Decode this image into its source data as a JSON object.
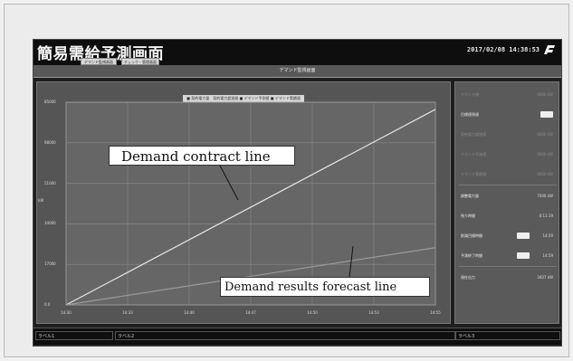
{
  "app": {
    "title": "簡易需給予測画面",
    "datetime": "2017/02/08 14:38:53",
    "buttons": [
      "デマンド監視画面",
      "チェック・管理画面"
    ],
    "logo_icon": "brand-logo-icon"
  },
  "subheader": {
    "title": "デマンド監視画面"
  },
  "chart_data": {
    "type": "line",
    "legend_text": "■ 契約電力量　契約電力超過値 ■ デマンド予測値 ■ デマンド実績値",
    "y_ticks": [
      "85000",
      "68000",
      "51000",
      "34000",
      "17000",
      "0.0"
    ],
    "ylabel": "kW",
    "x_ticks": [
      "14:30",
      "14:33",
      "14:40",
      "14:47",
      "14:50",
      "14:53",
      "14:55"
    ],
    "ylim": [
      0,
      85000
    ],
    "series": [
      {
        "x": [
          0,
          6
        ],
        "y": [
          0,
          82000
        ],
        "color": "#e8e8e8"
      },
      {
        "x": [
          0,
          6
        ],
        "y": [
          0,
          24000
        ],
        "color": "#9a9a9a"
      }
    ],
    "grid": true
  },
  "side_panel": {
    "rows": [
      {
        "label": "デマンド値",
        "value": "0000 kW",
        "dim": true,
        "toggle": false
      },
      {
        "label": "目標値到達",
        "value": "",
        "dim": false,
        "toggle": true
      },
      {
        "label": "契約電力超過値",
        "value": "0000 kW",
        "dim": true,
        "toggle": false
      },
      {
        "label": "デマンド予測値",
        "value": "0000 kW",
        "dim": true,
        "toggle": false
      },
      {
        "label": "デマンド実績値",
        "value": "0000 kW",
        "dim": true,
        "toggle": false
      },
      {
        "label": "調整電力量",
        "value": "7000 kW",
        "dim": false,
        "toggle": false
      },
      {
        "label": "残り時間",
        "value": "0:11:19",
        "dim": false,
        "toggle": false
      },
      {
        "label": "削減目標時間",
        "value": "14:59",
        "dim": false,
        "toggle": true
      },
      {
        "label": "予測終了時間",
        "value": "14:59",
        "dim": false,
        "toggle": true
      },
      {
        "label": "現在出力",
        "value": "3407 kW",
        "dim": false,
        "toggle": false
      }
    ]
  },
  "status_bar": {
    "cells": [
      "ラベル1",
      "ラベル2",
      "ラベル3"
    ]
  },
  "annotations": {
    "contract": "Demand contract line",
    "forecast": "Demand results forecast line"
  }
}
